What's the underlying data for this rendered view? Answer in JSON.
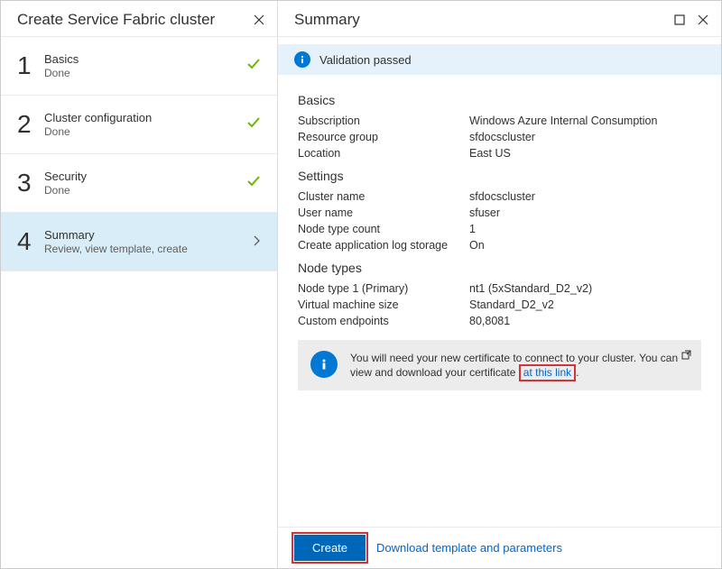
{
  "left": {
    "title": "Create Service Fabric cluster",
    "steps": [
      {
        "num": "1",
        "title": "Basics",
        "sub": "Done",
        "done": true
      },
      {
        "num": "2",
        "title": "Cluster configuration",
        "sub": "Done",
        "done": true
      },
      {
        "num": "3",
        "title": "Security",
        "sub": "Done",
        "done": true
      },
      {
        "num": "4",
        "title": "Summary",
        "sub": "Review, view template, create",
        "active": true
      }
    ]
  },
  "right": {
    "title": "Summary",
    "validation": "Validation passed",
    "sections": {
      "basics": {
        "heading": "Basics",
        "rows": [
          {
            "label": "Subscription",
            "value": "Windows Azure Internal Consumption"
          },
          {
            "label": "Resource group",
            "value": "sfdocscluster"
          },
          {
            "label": "Location",
            "value": "East US"
          }
        ]
      },
      "settings": {
        "heading": "Settings",
        "rows": [
          {
            "label": "Cluster name",
            "value": "sfdocscluster"
          },
          {
            "label": "User name",
            "value": "sfuser"
          },
          {
            "label": "Node type count",
            "value": "1"
          },
          {
            "label": "Create application log storage",
            "value": "On"
          }
        ]
      },
      "nodetypes": {
        "heading": "Node types",
        "rows": [
          {
            "label": "Node type 1 (Primary)",
            "value": "nt1 (5xStandard_D2_v2)"
          },
          {
            "label": "Virtual machine size",
            "value": "Standard_D2_v2"
          },
          {
            "label": "Custom endpoints",
            "value": "80,8081"
          }
        ]
      }
    },
    "cert": {
      "text_before": "You will need your new certificate to connect to your cluster. You can view and download your certificate ",
      "link": "at this link",
      "text_after": "."
    },
    "footer": {
      "create": "Create",
      "download": "Download template and parameters"
    }
  }
}
